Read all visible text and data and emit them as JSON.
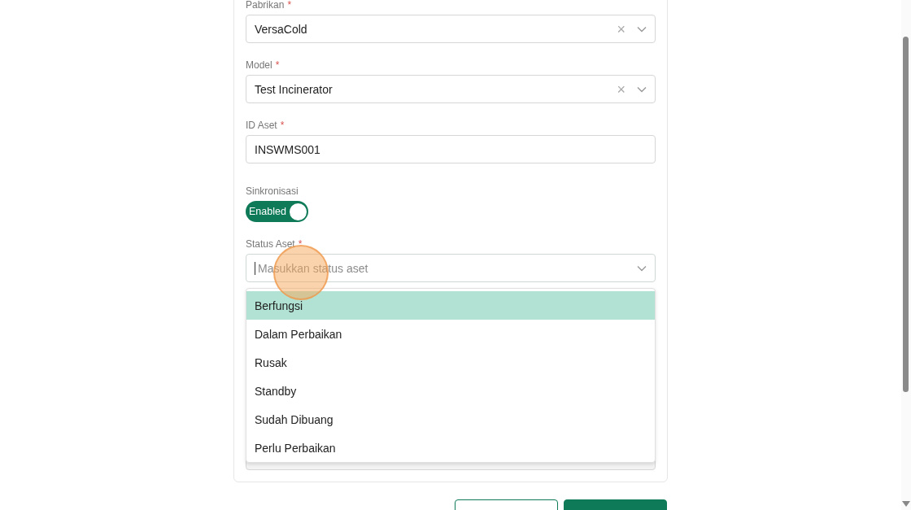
{
  "form": {
    "fields": [
      {
        "kind": "select",
        "label": "Pabrikan",
        "required": true,
        "value": "VersaCold",
        "clearable": true
      },
      {
        "kind": "select",
        "label": "Model",
        "required": true,
        "value": "Test Incinerator",
        "clearable": true
      },
      {
        "kind": "text",
        "label": "ID Aset",
        "required": true,
        "value": "INSWMS001"
      },
      {
        "kind": "toggle",
        "label": "Sinkronisasi",
        "required": false,
        "on": true,
        "text": "Enabled"
      },
      {
        "kind": "select",
        "label": "Status Aset",
        "required": true,
        "placeholder": "Masukkan status aset",
        "clearable": false,
        "focused": true
      }
    ]
  },
  "dropdown": {
    "options": [
      {
        "label": "Berfungsi",
        "selected": true
      },
      {
        "label": "Dalam Perbaikan",
        "selected": false
      },
      {
        "label": "Rusak",
        "selected": false
      },
      {
        "label": "Standby",
        "selected": false
      },
      {
        "label": "Sudah Dibuang",
        "selected": false
      },
      {
        "label": "Perlu Perbaikan",
        "selected": false
      }
    ]
  },
  "required_mark": "*",
  "clear_glyph": "×"
}
